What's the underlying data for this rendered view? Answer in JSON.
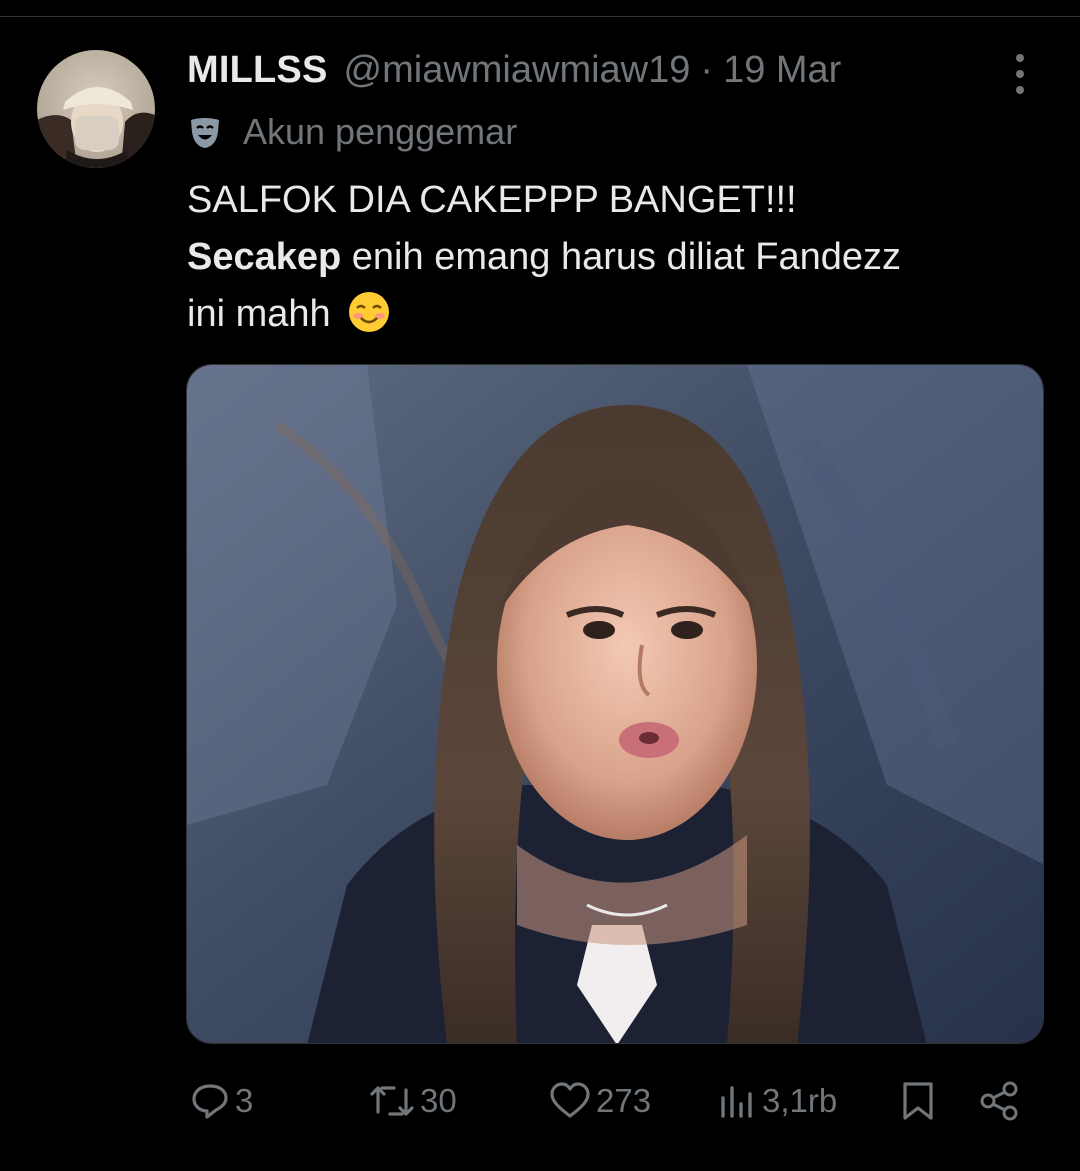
{
  "tweet": {
    "display_name": "MILLSS",
    "handle": "@miawmiawmiaw19",
    "separator": "·",
    "date": "19 Mar",
    "account_label": "Akun penggemar",
    "text_line1": "SALFOK DIA CAKEPPP BANGET!!!",
    "text_line2_bold": "Secakep",
    "text_line2_rest": " enih emang harus diliat Fandezz",
    "text_line3": "ini mahh",
    "emoji": "smiling-face-with-blush"
  },
  "actions": {
    "reply_count": "3",
    "retweet_count": "30",
    "like_count": "273",
    "views_count": "3,1rb"
  },
  "colors": {
    "background": "#000000",
    "primary_text": "#e7e9ea",
    "secondary_text": "#71767b",
    "divider": "#2f3336"
  },
  "icons": {
    "label": "theater-mask-icon",
    "more": "more-vertical-icon",
    "reply": "reply-icon",
    "retweet": "retweet-icon",
    "like": "heart-icon",
    "views": "views-icon",
    "bookmark": "bookmark-icon",
    "share": "share-icon"
  }
}
